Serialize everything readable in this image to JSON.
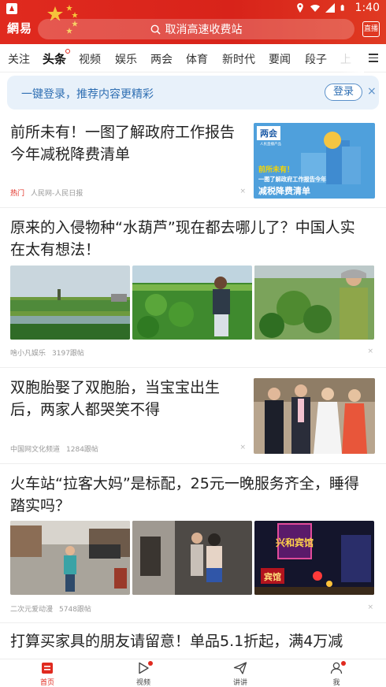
{
  "status_bar": {
    "time": "1:40"
  },
  "header": {
    "logo": "網易",
    "search_placeholder": "取消高速收费站",
    "news_button": "直播"
  },
  "tabs": [
    "关注",
    "头条",
    "视频",
    "娱乐",
    "两会",
    "体育",
    "新时代",
    "要闻",
    "段子",
    "上"
  ],
  "active_tab": "头条",
  "login_banner": {
    "text": "一键登录，推荐内容更精彩",
    "button": "登录",
    "close": "×"
  },
  "articles": [
    {
      "title_line1": "前所未有！一图了解政府工作报告",
      "title_line2": "今年减税降费清单",
      "tag": "热门",
      "source": "人民网-人民日报",
      "image_badge": "两会",
      "image_sub": "人民直播产品",
      "image_caption1": "前所未有！",
      "image_caption2": "一图了解政府工作报告今年",
      "image_caption3": "减税降费清单"
    },
    {
      "title_line1": "原来的入侵物种“水葫芦”现在都去哪儿了？中国人实",
      "title_line2": "在太有想法！",
      "source": "啥小凡娱乐",
      "comments": "3197跟帖"
    },
    {
      "title_line1": "双胞胎娶了双胞胎，当宝宝出生",
      "title_line2": "后，两家人都哭笑不得",
      "source": "中国网文化频道",
      "comments": "1284跟帖"
    },
    {
      "title_line1": "火车站“拉客大妈”是标配，25元一晚服务齐全，睡得",
      "title_line2": "踏实吗？",
      "source": "二次元爱动漫",
      "comments": "5748跟帖",
      "sign1": "兴和宾馆",
      "sign2": "宾馆"
    },
    {
      "title_line1": "打算买家具的朋友请留意！单品5.1折起，满4万减"
    }
  ],
  "dismiss_label": "×",
  "bottom_nav": [
    {
      "label": "首页",
      "icon": "home-icon"
    },
    {
      "label": "视频",
      "icon": "play-icon"
    },
    {
      "label": "讲讲",
      "icon": "paper-plane-icon"
    },
    {
      "label": "我",
      "icon": "user-icon"
    }
  ],
  "colors": {
    "brand_red": "#e02a1f",
    "banner_bg": "#e8f1fa",
    "banner_text": "#2f6fb3"
  }
}
